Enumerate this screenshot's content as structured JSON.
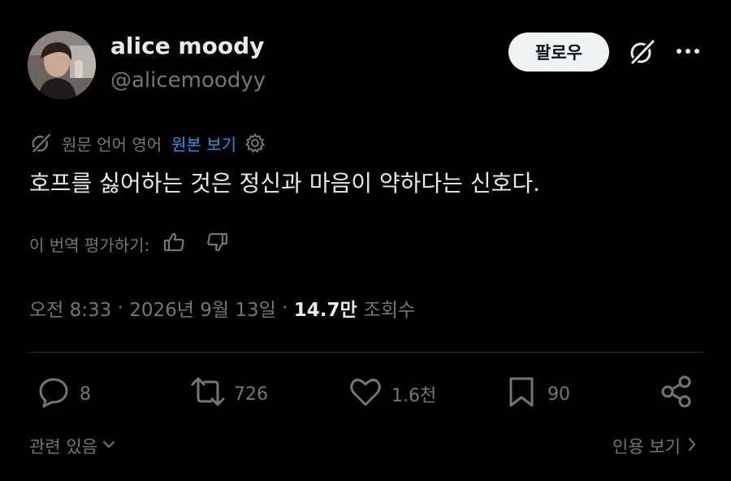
{
  "user": {
    "display_name": "alice moody",
    "handle": "@alicemoodyy"
  },
  "header": {
    "follow_label": "팔로우"
  },
  "translation": {
    "info": "원문 언어 영어",
    "show_original": "원본 보기"
  },
  "tweet": {
    "text": "호프를 싫어하는 것은 정신과 마음이 약하다는 신호다."
  },
  "rating": {
    "label": "이 번역 평가하기:"
  },
  "meta": {
    "time": "오전 8:33",
    "separator1": " · ",
    "date": "2026년 9월 13일",
    "separator2": " · ",
    "views_count": "14.7만",
    "views_label": "조회수"
  },
  "actions": {
    "replies": "8",
    "reposts": "726",
    "likes": "1.6천",
    "bookmarks": "90"
  },
  "footer": {
    "related": "관련 있음",
    "view_quotes": "인용 보기"
  },
  "colors": {
    "background": "#000000",
    "text_primary": "#e7e9ea",
    "text_secondary": "#71767b",
    "link": "#1d9bf0",
    "follow_bg": "#eff3f4",
    "divider": "#2f3336"
  }
}
